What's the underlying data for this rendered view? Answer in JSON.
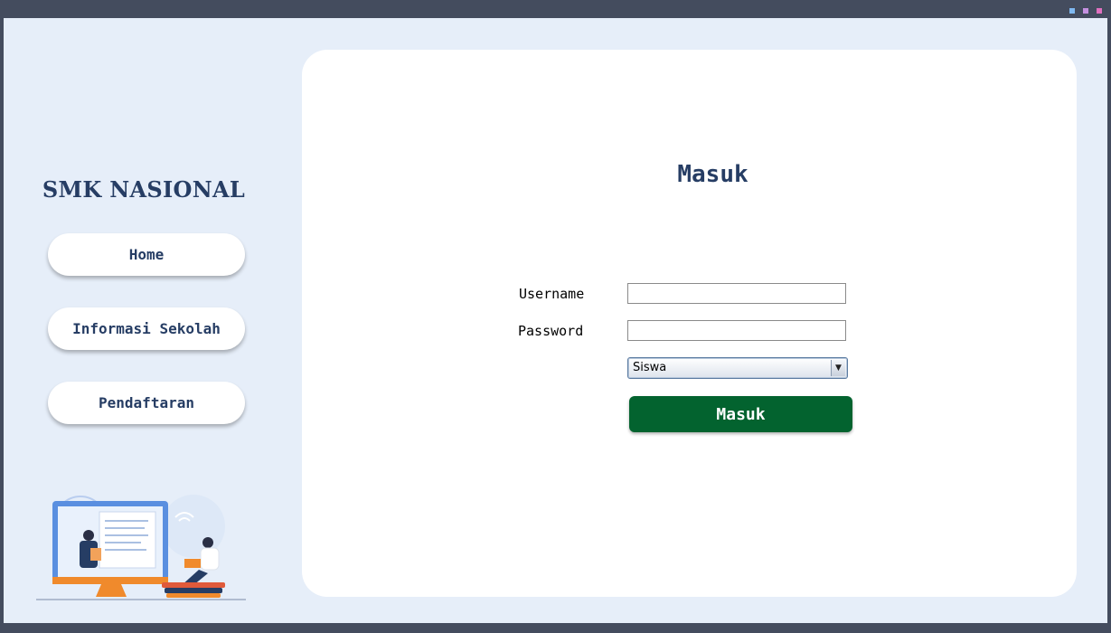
{
  "window": {
    "controls": [
      "minimize-icon",
      "maximize-icon",
      "close-icon"
    ],
    "control_colors": [
      "#7fb8f0",
      "#c490e0",
      "#e070c0"
    ]
  },
  "sidebar": {
    "brand": "SMK NASIONAL",
    "nav": [
      {
        "label": "Home"
      },
      {
        "label": "Informasi Sekolah"
      },
      {
        "label": "Pendaftaran"
      }
    ],
    "illustration": "students-online-learning-illustration"
  },
  "login": {
    "title": "Masuk",
    "username_label": "Username",
    "username_value": "",
    "password_label": "Password",
    "password_value": "",
    "role_selected": "Siswa",
    "submit_label": "Masuk"
  },
  "colors": {
    "background": "#e6eef9",
    "primary_text": "#263d64",
    "submit_button": "#03632f",
    "frame": "#444c5e"
  }
}
